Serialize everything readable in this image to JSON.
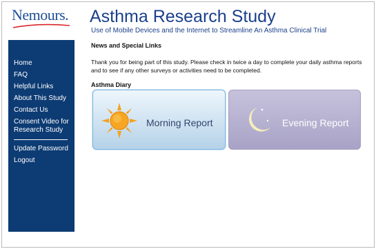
{
  "header": {
    "logo_text": "Nemours.",
    "title": "Asthma Research Study",
    "subtitle": "Use of Mobile Devices and the Internet to Streamline An Asthma Clinical Trial"
  },
  "sidebar": {
    "items": [
      {
        "label": "Home"
      },
      {
        "label": "FAQ"
      },
      {
        "label": "Helpful Links"
      },
      {
        "label": "About This Study"
      },
      {
        "label": "Contact Us"
      },
      {
        "label": "Consent Video for Research Study"
      }
    ],
    "account_items": [
      {
        "label": "Update Password"
      },
      {
        "label": "Logout"
      }
    ]
  },
  "main": {
    "news_heading": "News and Special Links",
    "notice": "Thank you for being part of this study. Please check in twice a day to complete your daily asthma reports and to see if any other surveys or activities need to be completed.",
    "diary_heading": "Asthma Diary",
    "reports": {
      "morning": {
        "label": "Morning Report",
        "icon": "sun-icon"
      },
      "evening": {
        "label": "Evening Report",
        "icon": "moon-icon"
      }
    }
  },
  "colors": {
    "brand_blue": "#1a3f8a",
    "sidebar_bg": "#0d3b73",
    "morning_bg": "#c9e0f1",
    "evening_bg": "#b0abcb",
    "sun": "#f4a21f",
    "moon": "#f5eebc"
  }
}
